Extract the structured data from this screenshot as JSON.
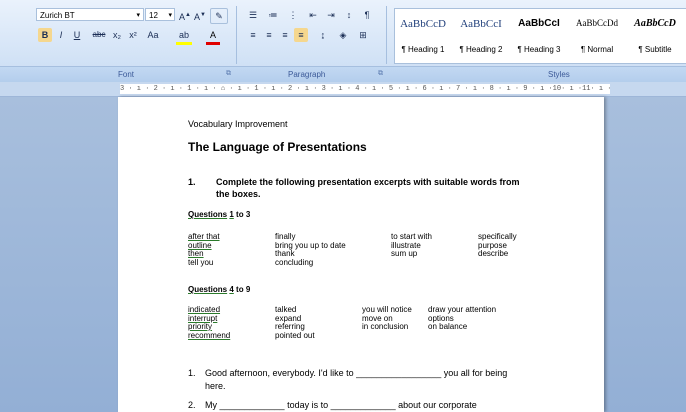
{
  "ribbon": {
    "font_name": "Zurich BT",
    "font_size": "12",
    "group_font": "Font",
    "group_paragraph": "Paragraph",
    "group_styles": "Styles",
    "styles": [
      {
        "sample": "AaBbCcD",
        "name": "¶ Heading 1",
        "color": "#1f3e7a"
      },
      {
        "sample": "AaBbCcI",
        "name": "¶ Heading 2",
        "color": "#1f3e7a"
      },
      {
        "sample": "AaBbCcI",
        "name": "¶ Heading 3",
        "color": "#000000"
      },
      {
        "sample": "AaBbCcDd",
        "name": "¶ Normal",
        "color": "#000000"
      },
      {
        "sample": "AaBbCcD",
        "name": "¶ Subtitle",
        "color": "#000000"
      }
    ]
  },
  "ruler": {
    "text": "3 · ı · 2 · ı · 1 · ı · ⌂ · ı · 1 · ı · 2 · ı · 3 · ı · 4 · ı · 5 · ı · 6 · ı · 7 · ı · 8 · ı · 9 · ı ·10· ı ·11· ı ·12· ı ·13· ı ·14· ı ·15· ⌂16· ı ·17· ı ·18· ı"
  },
  "document": {
    "line1": "Vocabulary Improvement",
    "heading": "The Language of Presentations",
    "task_num": "1.",
    "task_line1": "Complete the following presentation excerpts with suitable words from",
    "task_line2": "the boxes.",
    "q1_header_a": "Questions",
    "q1_header_b": "1",
    "q1_header_c": "to 3",
    "box1": {
      "col1": [
        "after that",
        "outline",
        "then",
        "tell you"
      ],
      "col2": [
        "finally",
        "bring you up to date",
        "thank",
        "concluding"
      ],
      "col3": [
        "to start with",
        "illustrate",
        "sum up"
      ],
      "col4": [
        "specifically",
        "purpose",
        "describe"
      ]
    },
    "q2_header_a": "Questions",
    "q2_header_b": "4",
    "q2_header_c": "to 9",
    "box2": {
      "col1": [
        "indicated",
        "interrupt",
        "priority",
        "recommend"
      ],
      "col2": [
        "talked",
        "expand",
        "referring",
        "pointed out"
      ],
      "col3": [
        "you will notice",
        "move on",
        "in conclusion"
      ],
      "col4": [
        "draw your attention",
        "options",
        "on balance"
      ]
    },
    "item1_num": "1.",
    "item1_a": "Good  afternoon,  everybody.   I'd  like  to  _________________  you  all  for  being",
    "item1_b": "here.",
    "item2_num": "2.",
    "item2_a": "My  _____________  today  is  to  _____________  about  our  corporate"
  }
}
